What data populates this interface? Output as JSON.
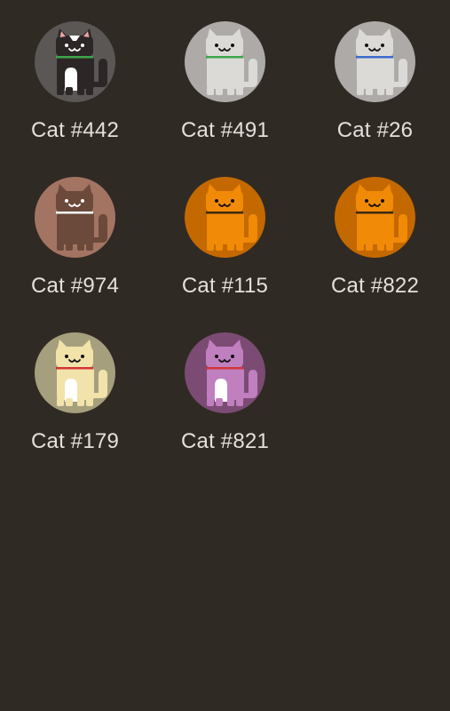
{
  "cats": [
    {
      "name": "Cat #442",
      "bg": "#5b5754",
      "body": "#2c2626",
      "accent": "#ffffff",
      "collar": "#3ea54b",
      "ears": "#e9a3a5",
      "chest": "#ffffff",
      "icon": "cat-black-white-icon"
    },
    {
      "name": "Cat #491",
      "bg": "#aeaaa7",
      "body": "#dcdad7",
      "accent": "#ffffff",
      "collar": "#3ea54b",
      "ears": "#dcdad7",
      "chest": "#dcdad7",
      "icon": "cat-white-icon"
    },
    {
      "name": "Cat #26",
      "bg": "#aeaaa7",
      "body": "#dcdad7",
      "accent": "#ffffff",
      "collar": "#3c6dcc",
      "ears": "#dcdad7",
      "chest": "#dcdad7",
      "icon": "cat-white-icon"
    },
    {
      "name": "Cat #974",
      "bg": "#a47463",
      "body": "#6b4a3b",
      "accent": "#ffffff",
      "collar": "#ffffff",
      "ears": "#6b4a3b",
      "chest": "#6b4a3b",
      "icon": "cat-brown-icon"
    },
    {
      "name": "Cat #115",
      "bg": "#c46900",
      "body": "#f08a07",
      "accent": "#ffffff",
      "collar": "#3a2a10",
      "ears": "#f08a07",
      "chest": "#f08a07",
      "icon": "cat-orange-icon"
    },
    {
      "name": "Cat #822",
      "bg": "#c46900",
      "body": "#f08a07",
      "accent": "#ffffff",
      "collar": "#3a2a10",
      "ears": "#f08a07",
      "chest": "#f08a07",
      "icon": "cat-orange-icon"
    },
    {
      "name": "Cat #179",
      "bg": "#a59f7d",
      "body": "#f2e3ab",
      "accent": "#ffffff",
      "collar": "#d23535",
      "ears": "#f2e3ab",
      "chest": "#ffffff",
      "icon": "cat-cream-icon"
    },
    {
      "name": "Cat #821",
      "bg": "#7b4b73",
      "body": "#c07fbf",
      "accent": "#ffffff",
      "collar": "#d23535",
      "ears": "#c07fbf",
      "chest": "#ffffff",
      "icon": "cat-purple-icon"
    }
  ]
}
